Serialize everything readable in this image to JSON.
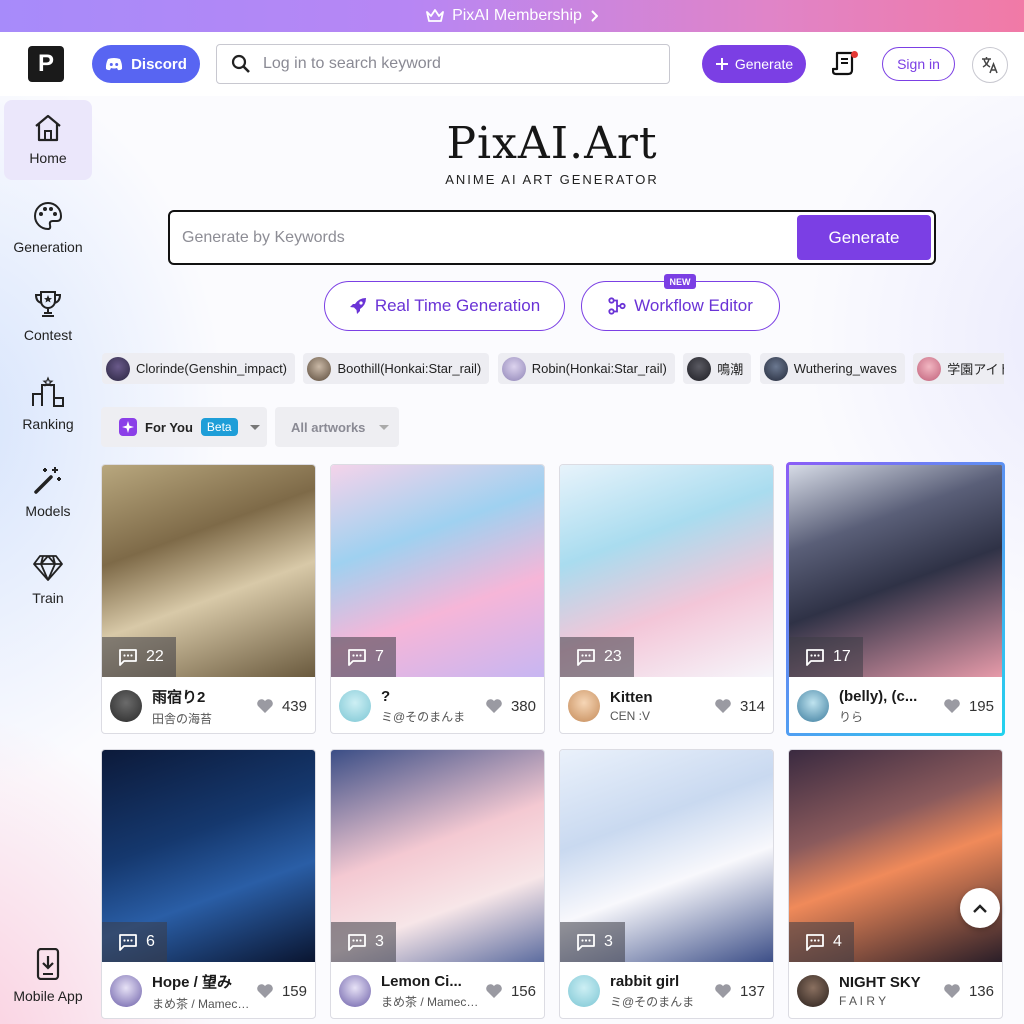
{
  "banner": {
    "text": "PixAI Membership",
    "icon": "crown-icon"
  },
  "header": {
    "logo_letter": "P",
    "discord_label": "Discord",
    "search_placeholder": "Log in to search keyword",
    "generate_label": "Generate",
    "signin_label": "Sign in",
    "language_icon": "translate-icon"
  },
  "sidebar": {
    "items": [
      {
        "label": "Home",
        "icon": "home-icon",
        "active": true
      },
      {
        "label": "Generation",
        "icon": "palette-icon"
      },
      {
        "label": "Contest",
        "icon": "trophy-icon"
      },
      {
        "label": "Ranking",
        "icon": "ranking-icon"
      },
      {
        "label": "Models",
        "icon": "magic-wand-icon"
      },
      {
        "label": "Train",
        "icon": "diamond-icon"
      }
    ],
    "mobile_app_label": "Mobile App"
  },
  "hero": {
    "title": "PixAI.Art",
    "subtitle": "ANIME AI ART GENERATOR",
    "input_placeholder": "Generate by Keywords",
    "generate_label": "Generate",
    "realtime_label": "Real Time Generation",
    "workflow_label": "Workflow Editor",
    "new_badge": "NEW"
  },
  "tags": [
    "Clorinde(Genshin_impact)",
    "Boothill(Honkai:Star_rail)",
    "Robin(Honkai:Star_rail)",
    "鳴潮",
    "Wuthering_waves",
    "学園アイドルマスター"
  ],
  "filters": {
    "for_you_label": "For You",
    "beta_label": "Beta",
    "all_artworks_label": "All artworks"
  },
  "cards": [
    {
      "comments": "22",
      "title": "雨宿り2",
      "author": "田舎の海苔",
      "likes": "439"
    },
    {
      "comments": "7",
      "title": "?",
      "author": "ミ@そのまんま",
      "likes": "380"
    },
    {
      "comments": "23",
      "title": "Kitten",
      "author": "CEN :V",
      "likes": "314"
    },
    {
      "comments": "17",
      "title": "(belly), (c...",
      "author": "りら",
      "likes": "195"
    },
    {
      "comments": "6",
      "title": "Hope / 望み",
      "author": "まめ茶 / Mamecha",
      "likes": "159"
    },
    {
      "comments": "3",
      "title": "Lemon Ci...",
      "author": "まめ茶 / Mamecha",
      "likes": "156"
    },
    {
      "comments": "3",
      "title": "rabbit girl",
      "author": "ミ@そのまんま",
      "likes": "137"
    },
    {
      "comments": "4",
      "title": "NIGHT SKY",
      "author": "F A I R Y",
      "likes": "136"
    }
  ],
  "colors": {
    "accent": "#7b3fe4",
    "discord": "#5865f2",
    "beta": "#1e9ed8"
  }
}
